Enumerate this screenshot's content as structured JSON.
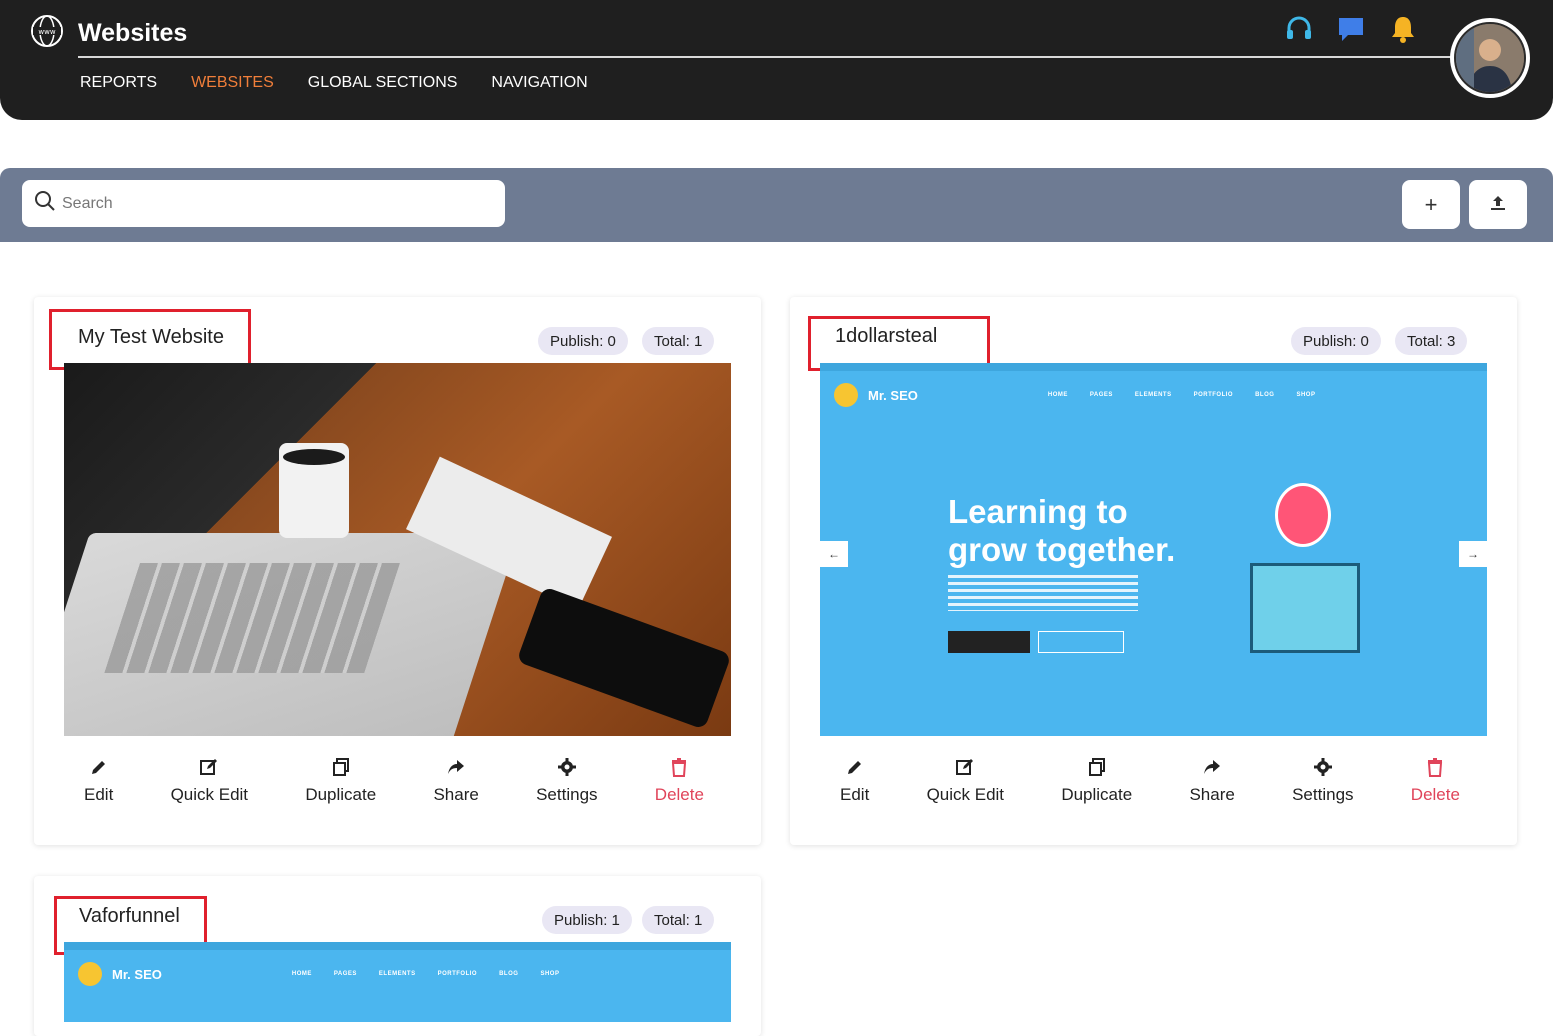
{
  "header": {
    "title": "Websites",
    "nav": [
      {
        "label": "REPORTS",
        "active": false
      },
      {
        "label": "WEBSITES",
        "active": true
      },
      {
        "label": "GLOBAL SECTIONS",
        "active": false
      },
      {
        "label": "NAVIGATION",
        "active": false
      }
    ],
    "icons": [
      "headset-icon",
      "chat-icon",
      "bell-icon"
    ],
    "accent": "#f07e3a"
  },
  "toolbar": {
    "search_placeholder": "Search",
    "add_label": "+",
    "upload_icon": "upload-icon"
  },
  "cards": [
    {
      "name": "My Test Website",
      "publish": "Publish: 0",
      "total": "Total: 1",
      "thumbnail": "photo",
      "actions": [
        "Edit",
        "Quick Edit",
        "Duplicate",
        "Share",
        "Settings",
        "Delete"
      ]
    },
    {
      "name": "1dollarsteal",
      "publish": "Publish: 0",
      "total": "Total: 3",
      "thumbnail": "site",
      "actions": [
        "Edit",
        "Quick Edit",
        "Duplicate",
        "Share",
        "Settings",
        "Delete"
      ]
    },
    {
      "name": "Vaforfunnel",
      "publish": "Publish: 1",
      "total": "Total: 1",
      "thumbnail": "site"
    }
  ],
  "site_preview": {
    "brand": "Mr. SEO",
    "menu": [
      "HOME",
      "PAGES",
      "ELEMENTS",
      "PORTFOLIO",
      "BLOG",
      "SHOP"
    ],
    "hero_line1": "Learning to",
    "hero_line2": "grow together."
  },
  "colors": {
    "header_bg": "#1f1f1f",
    "toolbar_bg": "#6e7b93",
    "highlight_border": "#e0202d",
    "delete": "#e0445a",
    "pill_bg": "#e9e7f4"
  }
}
